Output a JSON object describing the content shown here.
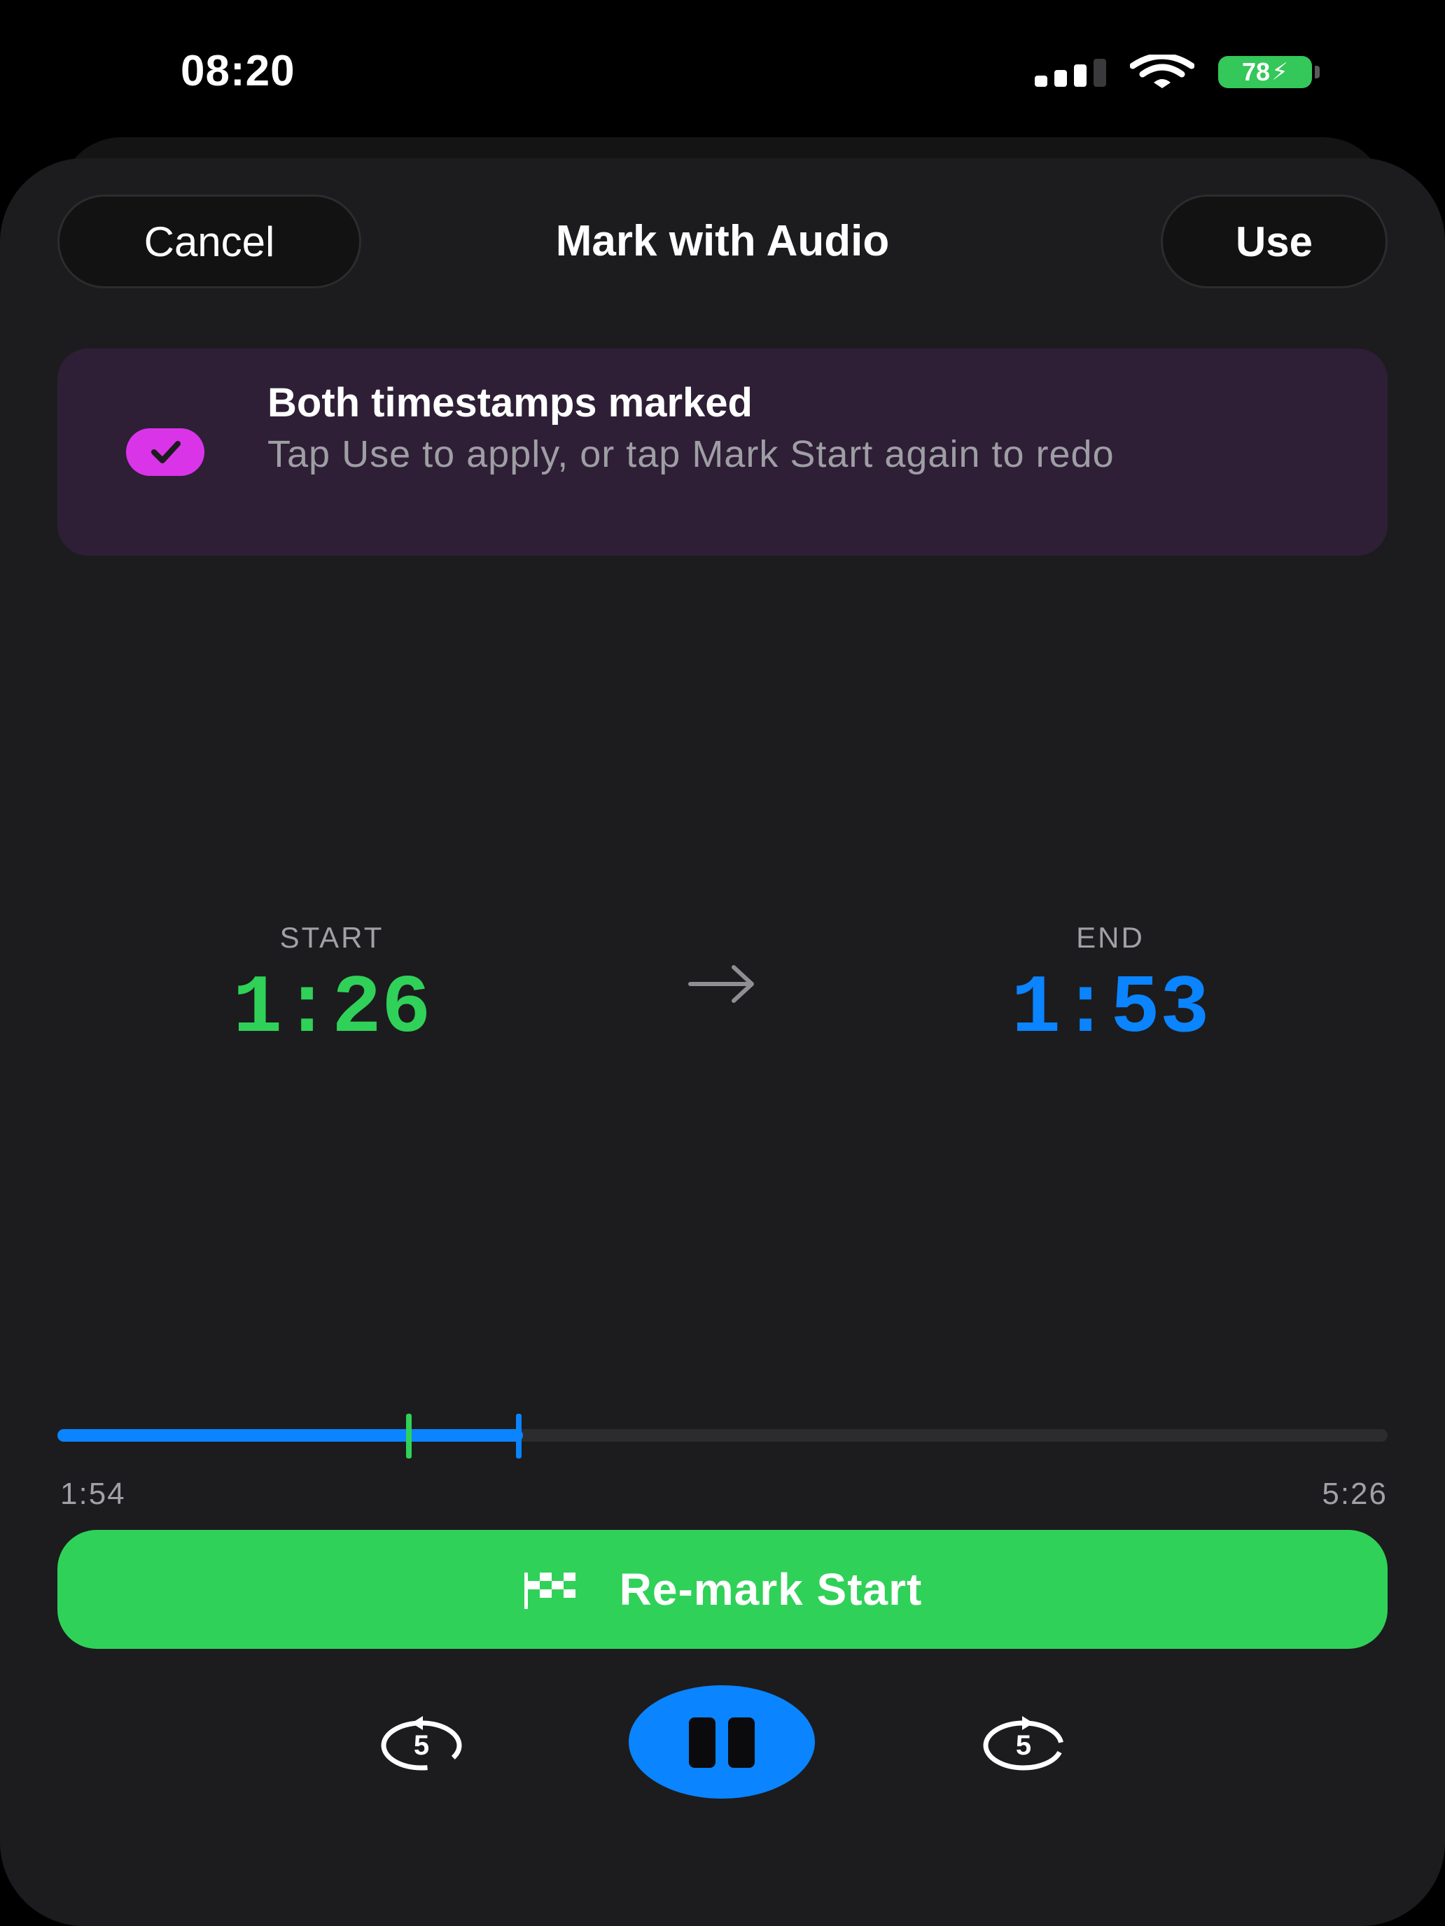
{
  "status_bar": {
    "time": "08:20",
    "battery_level": "78",
    "battery_color": "#34c759"
  },
  "header": {
    "cancel_label": "Cancel",
    "title": "Mark with Audio",
    "use_label": "Use"
  },
  "banner": {
    "title": "Both timestamps marked",
    "subtitle": "Tap Use to apply, or tap Mark Start again to redo",
    "icon": "checkmark-icon",
    "accent_color": "#da34e8"
  },
  "timestamps": {
    "start_label": "START",
    "start_value": "1:26",
    "start_color": "#30d158",
    "end_label": "END",
    "end_value": "1:53",
    "end_color": "#0a84ff"
  },
  "progress": {
    "elapsed": "1:54",
    "total": "5:26",
    "elapsed_fraction": 0.35,
    "start_marker_fraction": 0.264,
    "end_marker_fraction": 0.347
  },
  "remark_button": {
    "label": "Re-mark Start",
    "icon": "checkered-flag-icon"
  },
  "playback": {
    "skip_back_seconds": "5",
    "skip_forward_seconds": "5",
    "state_icon": "pause-icon"
  }
}
